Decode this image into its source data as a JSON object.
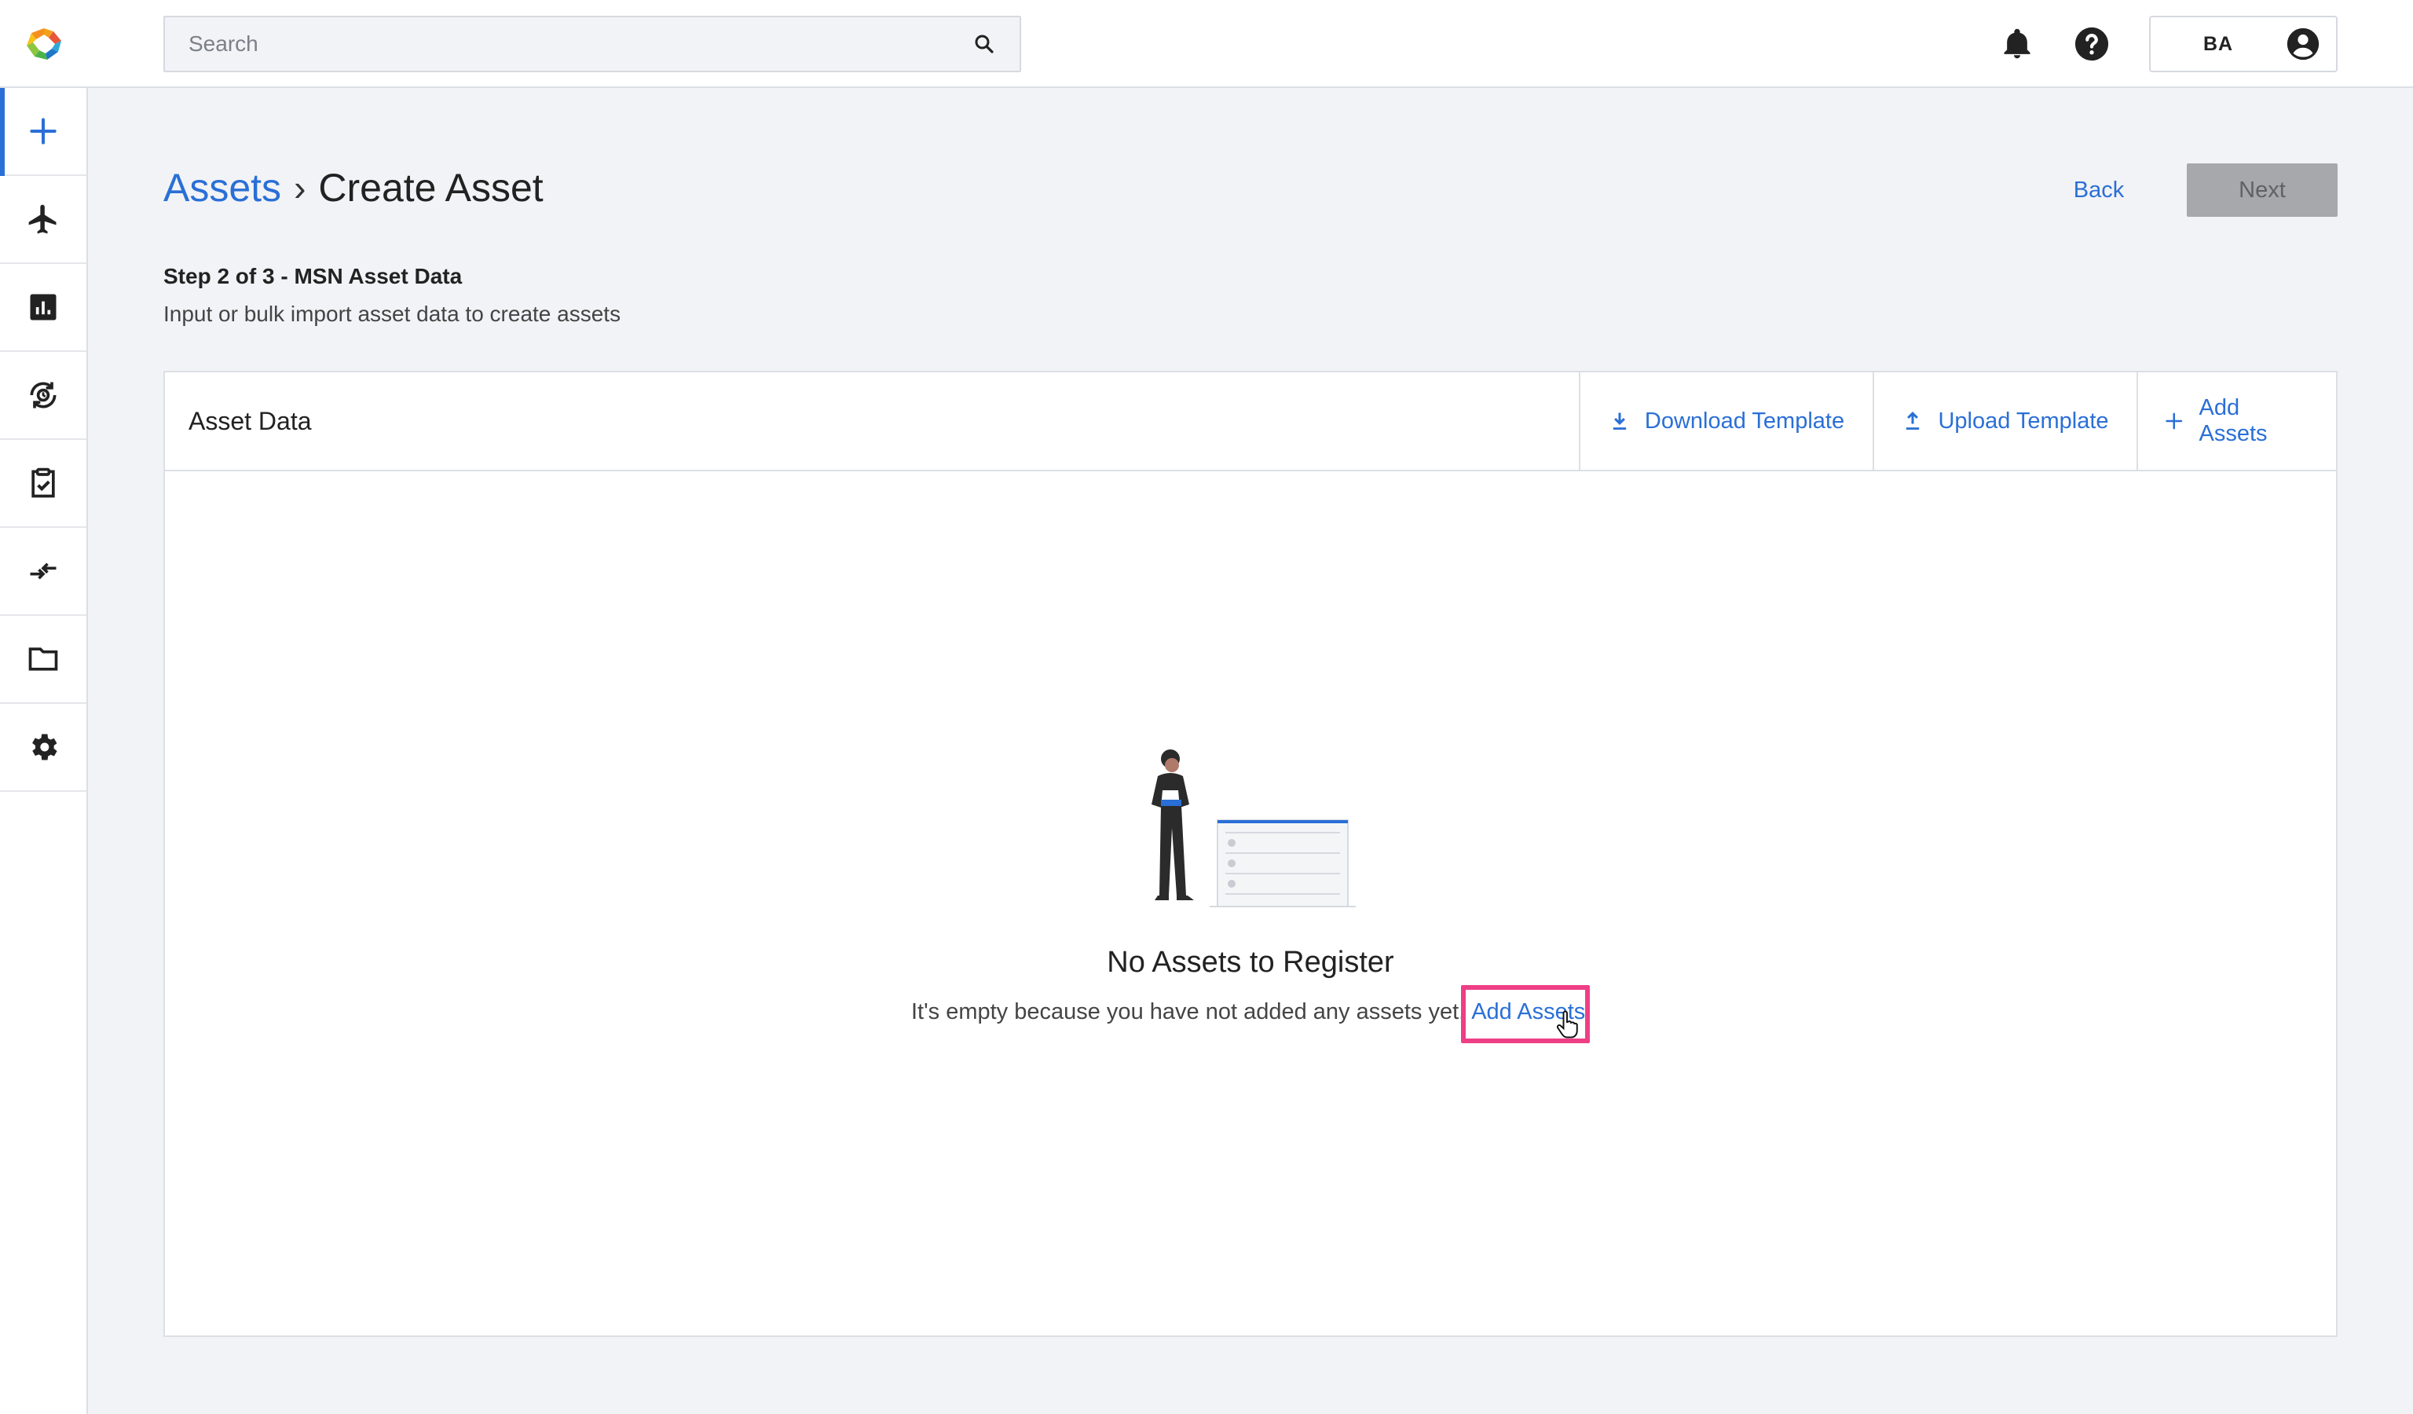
{
  "topbar": {
    "search_placeholder": "Search",
    "user_initials": "BA",
    "icons": [
      "app-logo",
      "search-icon",
      "bell-icon",
      "help-icon",
      "account-icon"
    ]
  },
  "sidebar": {
    "items": [
      {
        "icon": "plus-icon",
        "active": true
      },
      {
        "icon": "airplane-icon",
        "active": false
      },
      {
        "icon": "analytics-icon",
        "active": false
      },
      {
        "icon": "tracking-icon",
        "active": false
      },
      {
        "icon": "clipboard-check-icon",
        "active": false
      },
      {
        "icon": "transfer-icon",
        "active": false
      },
      {
        "icon": "folder-icon",
        "active": false
      },
      {
        "icon": "gear-icon",
        "active": false
      }
    ],
    "accent_color": "#2a6fd6"
  },
  "breadcrumb": {
    "parent": "Assets",
    "separator": "›",
    "current": "Create Asset"
  },
  "actions": {
    "back_label": "Back",
    "next_label": "Next"
  },
  "step": {
    "title": "Step 2 of 3 - MSN Asset Data",
    "subtitle": "Input or bulk import asset data to create assets"
  },
  "panel": {
    "title": "Asset Data",
    "download_label": "Download Template",
    "upload_label": "Upload Template",
    "add_label": "Add Assets"
  },
  "empty_state": {
    "title": "No Assets to Register",
    "message": "It's empty because you have not added any assets yet.",
    "link_label": "Add Assets"
  },
  "colors": {
    "link": "#2a6fd6",
    "highlight": "#ee3f86",
    "disabled_button": "#a6a8ac"
  }
}
